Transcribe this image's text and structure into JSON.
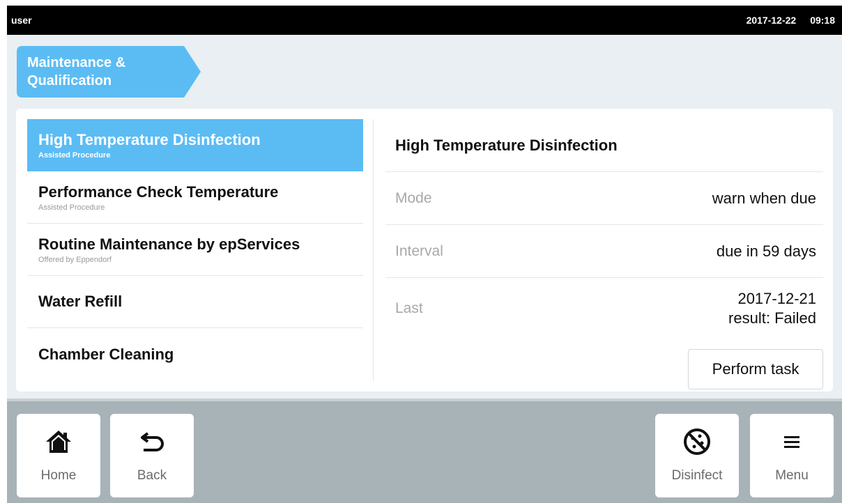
{
  "status": {
    "user": "user",
    "date": "2017-12-22",
    "time": "09:18"
  },
  "breadcrumb": {
    "label": "Maintenance & Qualification"
  },
  "tasks": [
    {
      "title": "High Temperature Disinfection",
      "subtitle": "Assisted Procedure"
    },
    {
      "title": "Performance Check Temperature",
      "subtitle": "Assisted Procedure"
    },
    {
      "title": "Routine Maintenance by epServices",
      "subtitle": "Offered by Eppendorf"
    },
    {
      "title": "Water Refill",
      "subtitle": ""
    },
    {
      "title": "Chamber Cleaning",
      "subtitle": ""
    }
  ],
  "selected_task": 0,
  "details": {
    "title": "High Temperature Disinfection",
    "mode": {
      "label": "Mode",
      "value": "warn when due"
    },
    "interval": {
      "label": "Interval",
      "value": "due in 59 days"
    },
    "last": {
      "label": "Last",
      "date": "2017-12-21",
      "result": "result: Failed"
    },
    "perform_label": "Perform task"
  },
  "bottom_nav": {
    "home": {
      "label": "Home",
      "icon": "home-icon"
    },
    "back": {
      "label": "Back",
      "icon": "back-arrow-icon"
    },
    "disinfect": {
      "label": "Disinfect",
      "icon": "disinfect-icon"
    },
    "menu": {
      "label": "Menu",
      "icon": "hamburger-menu-icon"
    }
  },
  "colors": {
    "accent": "#5bbcf4",
    "status_bar": "#000000",
    "screen_bg": "#e9eff2",
    "bottom_bar": "#a8b3b8"
  }
}
